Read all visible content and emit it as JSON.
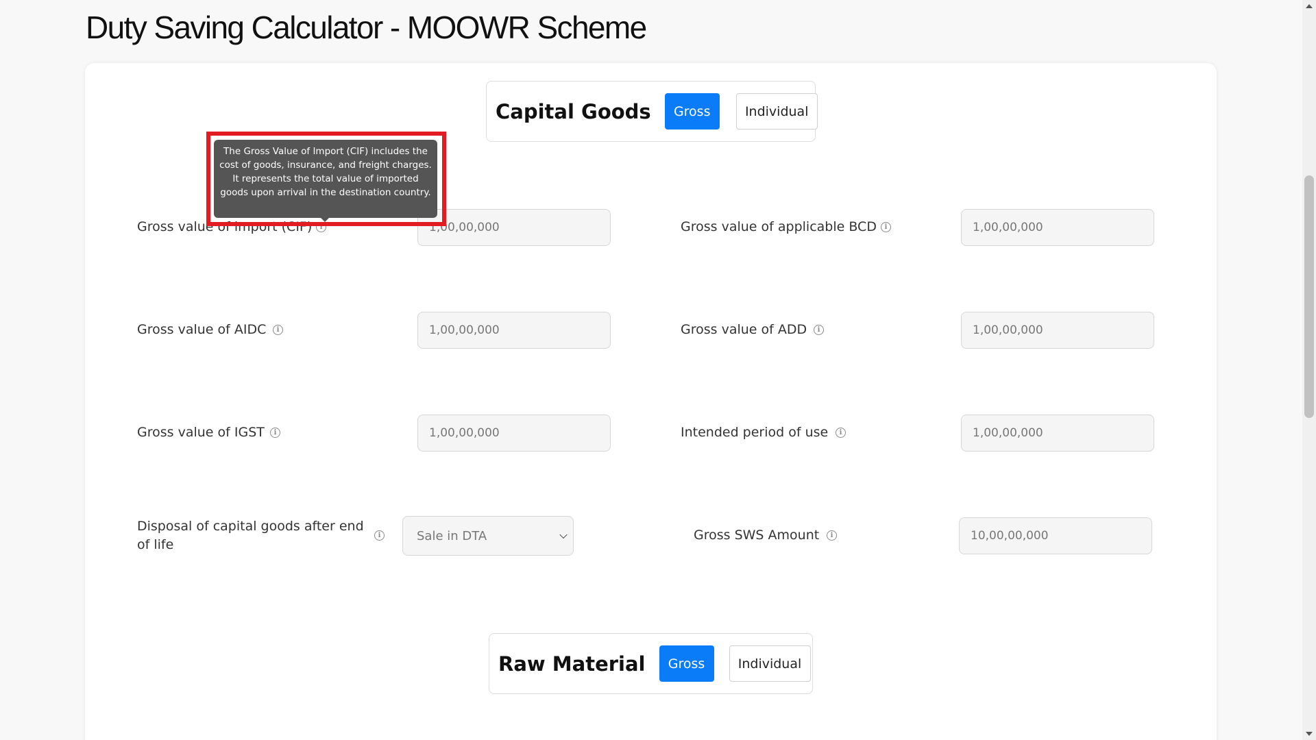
{
  "page": {
    "title": "Duty Saving Calculator - MOOWR Scheme"
  },
  "capital_goods": {
    "title": "Capital Goods",
    "gross_label": "Gross",
    "individual_label": "Individual"
  },
  "tooltip": {
    "text": "The Gross Value of Import (CIF) includes the cost of goods, insurance, and freight charges. It represents the total value of imported goods upon arrival in the destination country."
  },
  "fields": {
    "cif": {
      "label": "Gross value of import (CIF)",
      "placeholder": "1,00,00,000",
      "info_icon": "info-icon"
    },
    "bcd": {
      "label": "Gross value of applicable BCD",
      "placeholder": "1,00,00,000",
      "info_icon": "info-icon"
    },
    "aidc": {
      "label": "Gross value of AIDC",
      "placeholder": "1,00,00,000",
      "info_icon": "info-icon"
    },
    "add": {
      "label": "Gross value of ADD",
      "placeholder": "1,00,00,000",
      "info_icon": "info-icon"
    },
    "igst": {
      "label": "Gross value of IGST",
      "placeholder": "1,00,00,000",
      "info_icon": "info-icon"
    },
    "period": {
      "label": "Intended period of use",
      "placeholder": "1,00,00,000",
      "info_icon": "info-icon"
    },
    "disposal": {
      "label": "Disposal of capital goods after end of life",
      "selected": "Sale in DTA",
      "info_icon": "info-icon"
    },
    "sws": {
      "label": "Gross SWS Amount",
      "placeholder": "10,00,00,000",
      "info_icon": "info-icon"
    }
  },
  "raw_material": {
    "title": "Raw Material",
    "gross_label": "Gross",
    "individual_label": "Individual"
  },
  "colors": {
    "accent": "#0a7cf7",
    "highlight": "#e31b23",
    "tooltip_bg": "#555555"
  }
}
